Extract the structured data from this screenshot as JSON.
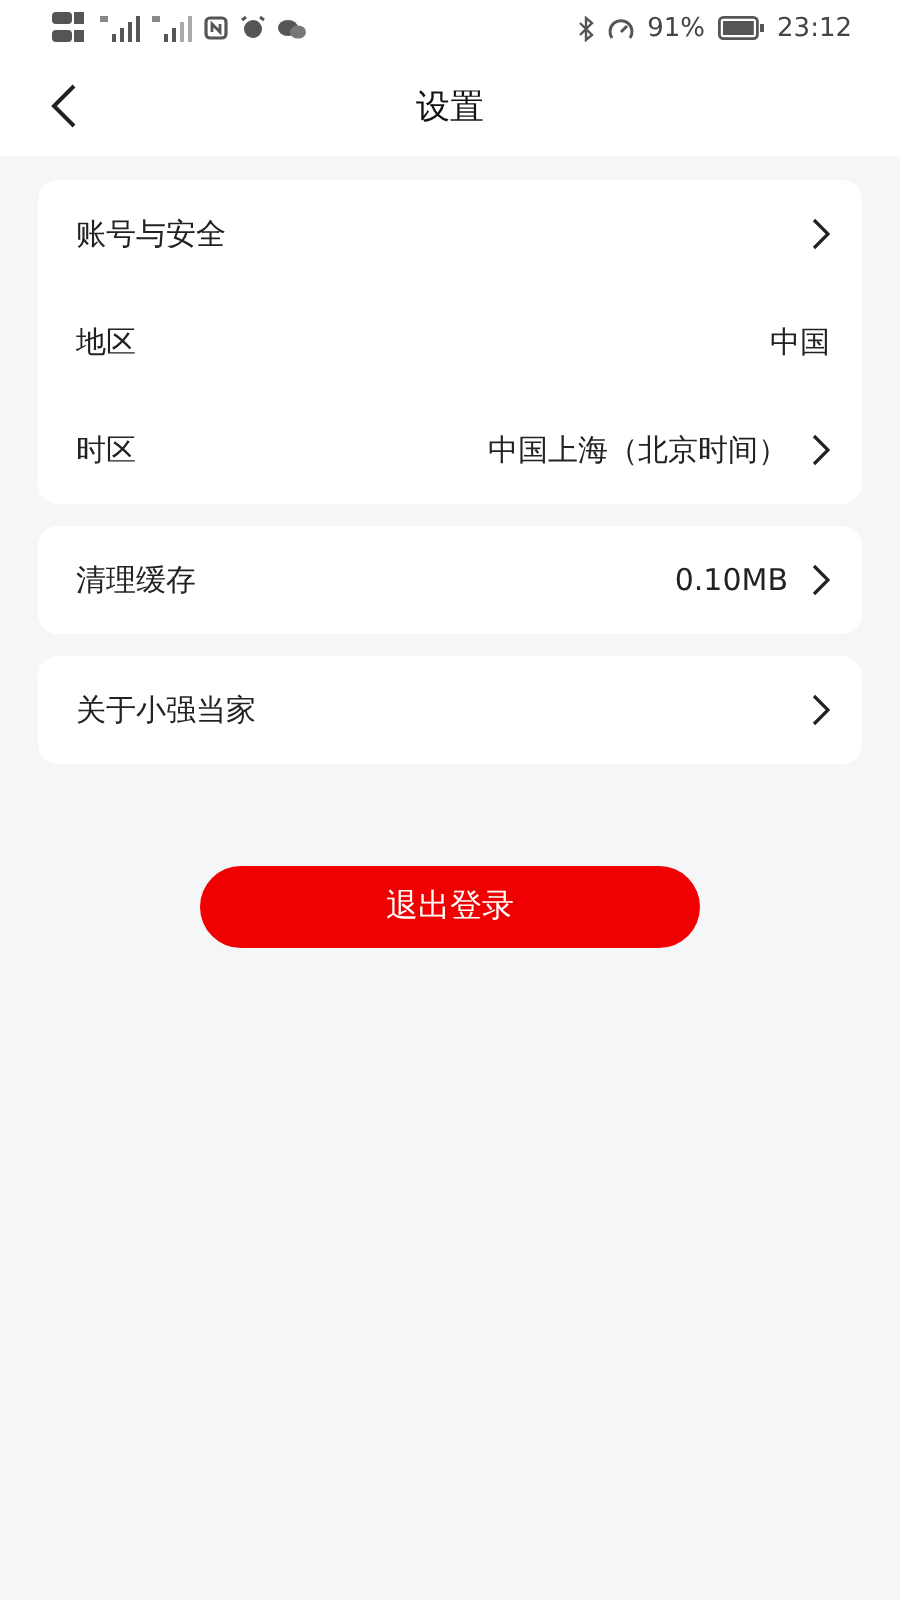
{
  "status_bar": {
    "battery": "91%",
    "time": "23:12"
  },
  "header": {
    "title": "设置"
  },
  "groups": [
    {
      "items": [
        {
          "label": "账号与安全",
          "value": "",
          "arrow": true
        },
        {
          "label": "地区",
          "value": "中国",
          "arrow": false
        },
        {
          "label": "时区",
          "value": "中国上海（北京时间）",
          "arrow": true
        }
      ]
    },
    {
      "items": [
        {
          "label": "清理缓存",
          "value": "0.10MB",
          "arrow": true
        }
      ]
    },
    {
      "items": [
        {
          "label": "关于小强当家",
          "value": "",
          "arrow": true
        }
      ]
    }
  ],
  "logout_button": "退出登录"
}
